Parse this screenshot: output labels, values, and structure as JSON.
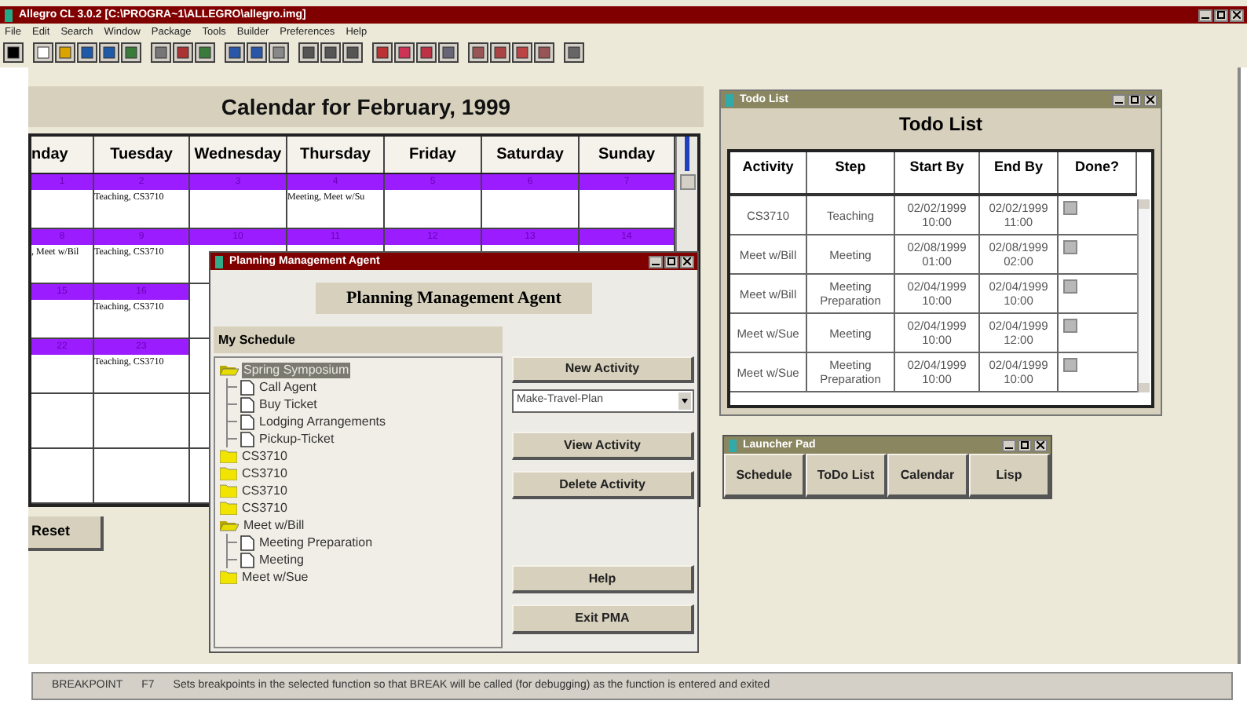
{
  "app_window": {
    "title": "Allegro CL 3.0.2 [C:\\PROGRA~1\\ALLEGRO\\allegro.img]",
    "menu": [
      "File",
      "Edit",
      "Search",
      "Window",
      "Package",
      "Tools",
      "Builder",
      "Preferences",
      "Help"
    ]
  },
  "calendar": {
    "title": "Calendar for February, 1999",
    "days": [
      "nday",
      "Tuesday",
      "Wednesday",
      "Thursday",
      "Friday",
      "Saturday",
      "Sunday"
    ],
    "weeks": [
      {
        "cells": [
          {
            "date": "1"
          },
          {
            "date": "2",
            "entry": "Teaching, CS3710"
          },
          {
            "date": "3"
          },
          {
            "date": "4",
            "entry": "Meeting, Meet w/Su"
          },
          {
            "date": "5"
          },
          {
            "date": "6"
          },
          {
            "date": "7"
          }
        ]
      },
      {
        "cells": [
          {
            "date": "8",
            "entry": ", Meet w/Bil"
          },
          {
            "date": "9",
            "entry": "Teaching, CS3710"
          },
          {
            "date": "10"
          },
          {
            "date": "11"
          },
          {
            "date": "12"
          },
          {
            "date": "13"
          },
          {
            "date": "14"
          }
        ]
      },
      {
        "cells": [
          {
            "date": "15"
          },
          {
            "date": "16",
            "entry": "Teaching, CS3710"
          }
        ]
      },
      {
        "cells": [
          {
            "date": "22"
          },
          {
            "date": "23",
            "entry": "Teaching, CS3710"
          }
        ]
      }
    ],
    "reset_button": "Reset"
  },
  "pma": {
    "title": "Planning Management Agent",
    "heading": "Planning Management Agent",
    "schedule_label": "My Schedule",
    "tree": [
      {
        "label": "Spring Symposium",
        "kind": "folder",
        "expanded": true,
        "selected": true,
        "children": [
          {
            "label": "Call Agent",
            "kind": "document",
            "selected": false
          },
          {
            "label": "Buy Ticket",
            "kind": "document",
            "selected": false
          },
          {
            "label": "Lodging Arrangements",
            "kind": "document",
            "selected": false
          },
          {
            "label": "Pickup-Ticket",
            "kind": "document",
            "selected": false
          }
        ]
      },
      {
        "label": "CS3710",
        "kind": "folder",
        "expanded": false,
        "selected": false
      },
      {
        "label": "CS3710",
        "kind": "folder",
        "expanded": false,
        "selected": false
      },
      {
        "label": "CS3710",
        "kind": "folder",
        "expanded": false,
        "selected": false
      },
      {
        "label": "CS3710",
        "kind": "folder",
        "expanded": false,
        "selected": false
      },
      {
        "label": "Meet w/Bill",
        "kind": "folder",
        "expanded": true,
        "selected": false,
        "children": [
          {
            "label": "Meeting Preparation",
            "kind": "document",
            "selected": false
          },
          {
            "label": "Meeting",
            "kind": "document",
            "selected": false
          }
        ]
      },
      {
        "label": "Meet w/Sue",
        "kind": "folder",
        "expanded": false,
        "selected": false
      }
    ],
    "new_button": "New Activity",
    "plan_dropdown": "Make-Travel-Plan",
    "view_button": "View Activity",
    "delete_button": "Delete Activity",
    "help_button": "Help",
    "exit_button": "Exit PMA"
  },
  "todo": {
    "title": "Todo List",
    "heading": "Todo List",
    "columns": [
      "Activity",
      "Step",
      "Start By",
      "End By",
      "Done?"
    ],
    "rows": [
      {
        "cells": [
          "CS3710",
          "Teaching",
          "02/02/1999 10:00",
          "02/02/1999 11:00"
        ],
        "done": false
      },
      {
        "cells": [
          "Meet w/Bill",
          "Meeting",
          "02/08/1999 01:00",
          "02/08/1999 02:00"
        ],
        "done": false
      },
      {
        "cells": [
          "Meet w/Bill",
          "Meeting Preparation",
          "02/04/1999 10:00",
          "02/04/1999 10:00"
        ],
        "done": false
      },
      {
        "cells": [
          "Meet w/Sue",
          "Meeting",
          "02/04/1999 10:00",
          "02/04/1999 12:00"
        ],
        "done": false
      },
      {
        "cells": [
          "Meet w/Sue",
          "Meeting Preparation",
          "02/04/1999 10:00",
          "02/04/1999 10:00"
        ],
        "done": false
      }
    ]
  },
  "launcher": {
    "title": "Launcher Pad",
    "buttons": [
      "Schedule",
      "ToDo List",
      "Calendar",
      "Lisp"
    ]
  },
  "status_bar": {
    "command": "BREAKPOINT",
    "key": "F7",
    "description": "Sets breakpoints in the selected function so that BREAK will be called (for debugging) as the function is entered and exited"
  }
}
